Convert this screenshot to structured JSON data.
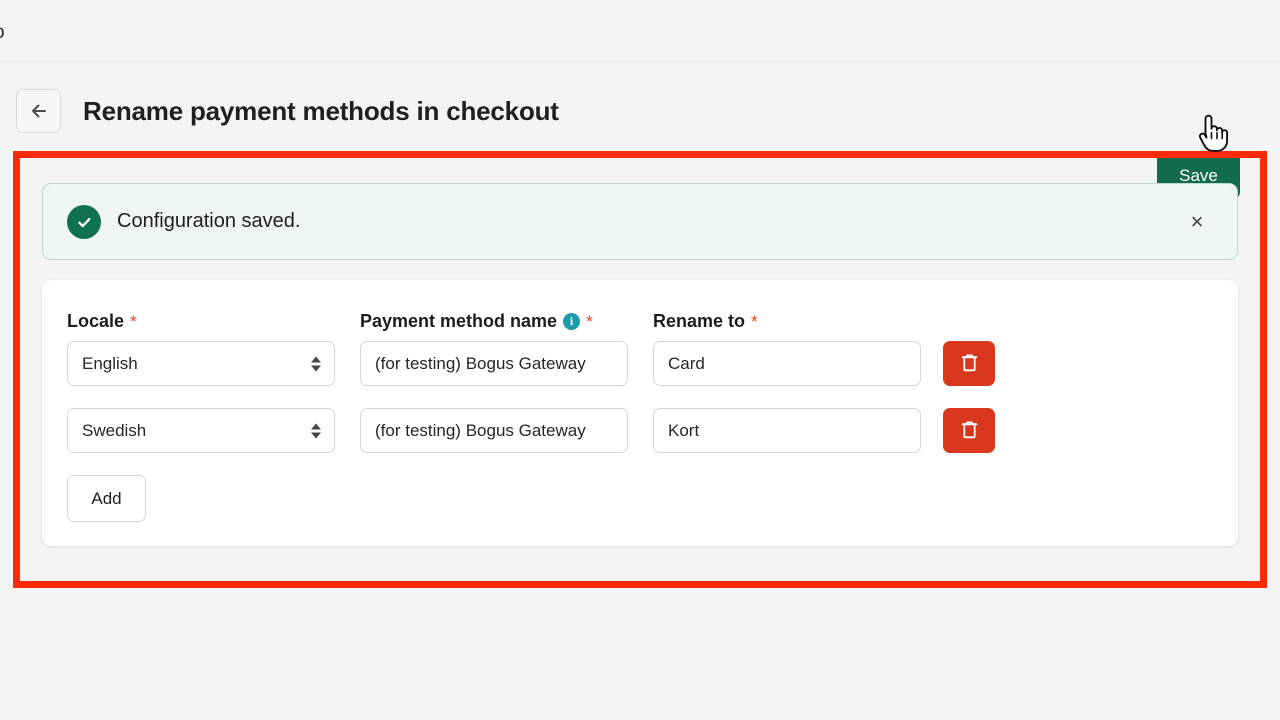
{
  "topbar": {
    "truncated_text": "o"
  },
  "header": {
    "back_icon": "arrow-left-icon",
    "title": "Rename payment methods in checkout",
    "save_label": "Save"
  },
  "banner": {
    "icon": "check-circle-icon",
    "message": "Configuration saved.",
    "close_label": "×"
  },
  "form": {
    "columns": {
      "locale": {
        "label": "Locale",
        "required_mark": "*"
      },
      "payment_method_name": {
        "label": "Payment method name",
        "required_mark": "*",
        "info_icon": "info-icon",
        "info_glyph": "i"
      },
      "rename_to": {
        "label": "Rename to",
        "required_mark": "*"
      }
    },
    "rows": [
      {
        "locale": "English",
        "payment_method_name": "(for testing) Bogus Gateway",
        "rename_to": "Card",
        "delete_icon": "trash-icon"
      },
      {
        "locale": "Swedish",
        "payment_method_name": "(for testing) Bogus Gateway",
        "rename_to": "Kort",
        "delete_icon": "trash-icon"
      }
    ],
    "add_label": "Add"
  },
  "annotation": {
    "highlight_color": "#fc2a06"
  },
  "colors": {
    "save_green": "#126b4d",
    "banner_bg": "#f0f7f3",
    "banner_border": "#bcd9cc",
    "success_green": "#10714e",
    "delete_red": "#d9381e",
    "info_teal": "#1f9cab",
    "required_red": "#e8401f",
    "page_bg": "#f4f4f4"
  },
  "cursor": {
    "type": "pointer-hand-cursor"
  }
}
